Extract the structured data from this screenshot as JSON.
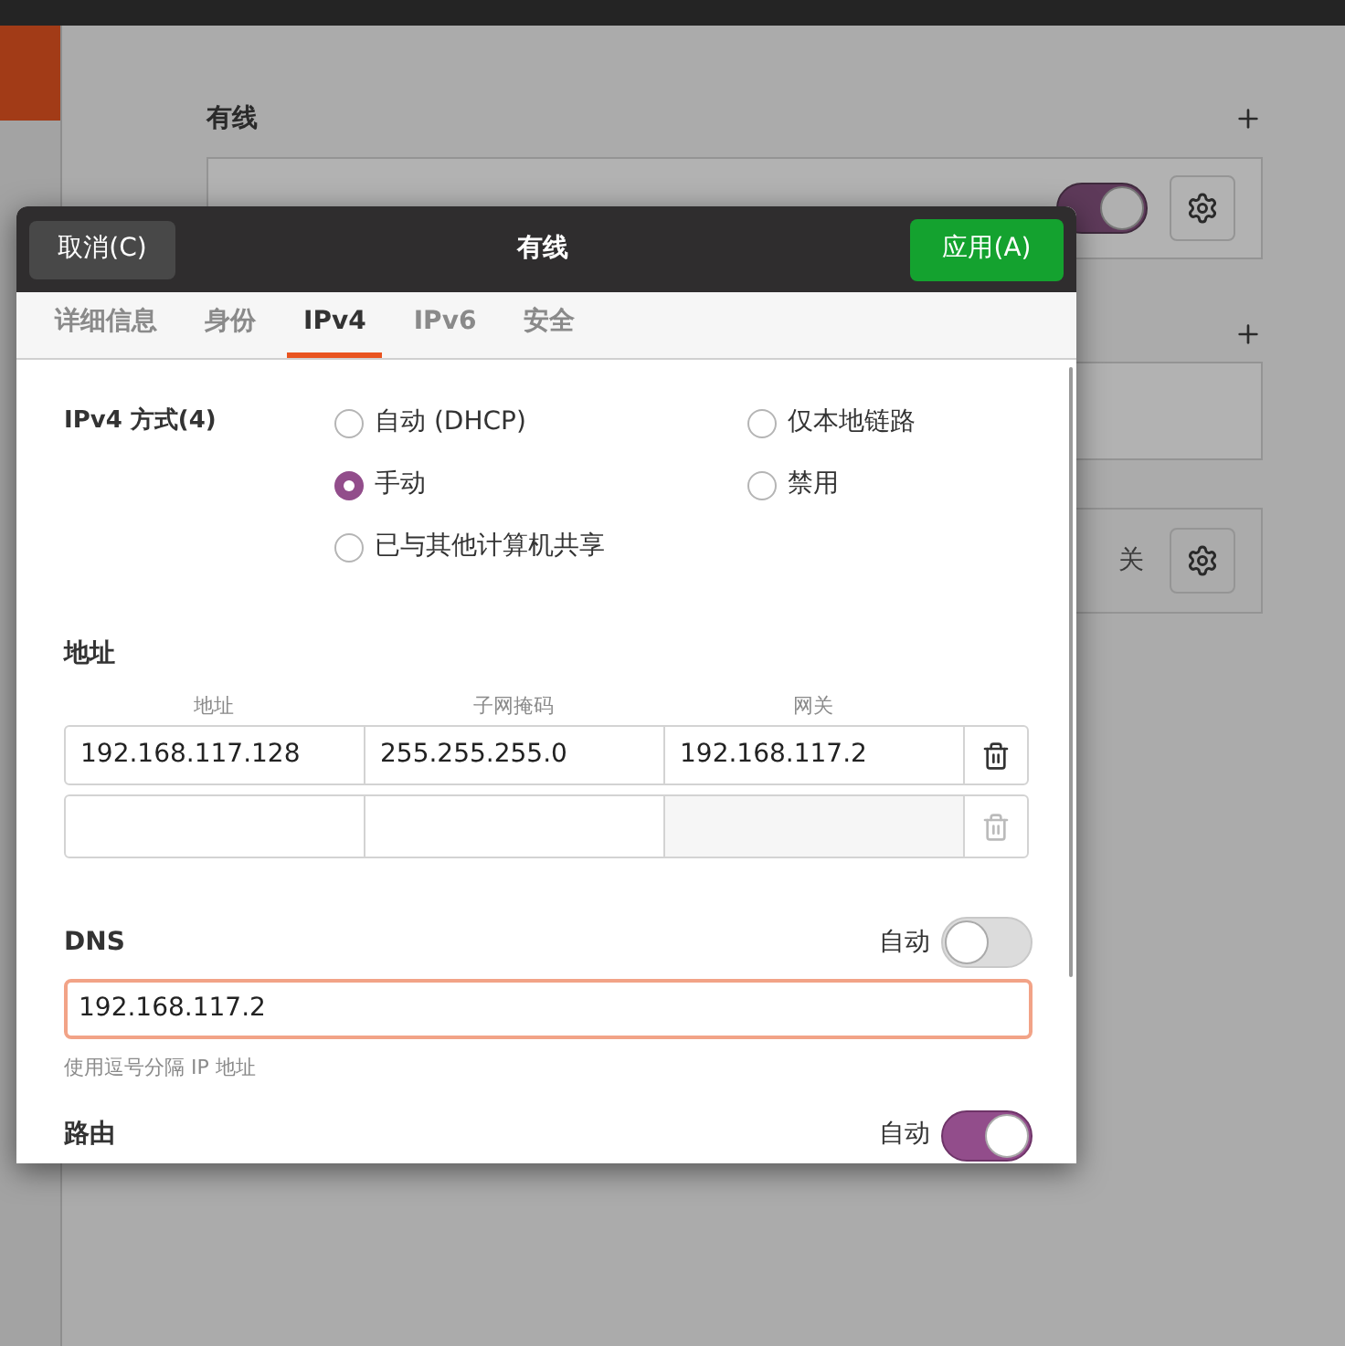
{
  "background": {
    "wired_title": "有线",
    "wired_toggle_on": true,
    "vpn_status": "关"
  },
  "dialog": {
    "cancel": "取消(C)",
    "title": "有线",
    "apply": "应用(A)",
    "tabs": [
      {
        "label": "详细信息",
        "selected": false
      },
      {
        "label": "身份",
        "selected": false
      },
      {
        "label": "IPv4",
        "selected": true
      },
      {
        "label": "IPv6",
        "selected": false
      },
      {
        "label": "安全",
        "selected": false
      }
    ],
    "method": {
      "label": "IPv4 方式(4)",
      "options": [
        {
          "label": "自动 (DHCP)",
          "selected": false
        },
        {
          "label": "仅本地链路",
          "selected": false
        },
        {
          "label": "手动",
          "selected": true
        },
        {
          "label": "禁用",
          "selected": false
        },
        {
          "label": "已与其他计算机共享",
          "selected": false
        }
      ]
    },
    "address": {
      "title": "地址",
      "columns": [
        "地址",
        "子网掩码",
        "网关"
      ],
      "rows": [
        {
          "cells": [
            "192.168.117.128",
            "255.255.255.0",
            "192.168.117.2"
          ]
        }
      ]
    },
    "dns": {
      "title": "DNS",
      "auto_label": "自动",
      "auto_on": false,
      "value": "192.168.117.2",
      "hint": "使用逗号分隔 IP 地址"
    },
    "routes": {
      "title": "路由",
      "auto_label": "自动",
      "auto_on": true
    }
  }
}
